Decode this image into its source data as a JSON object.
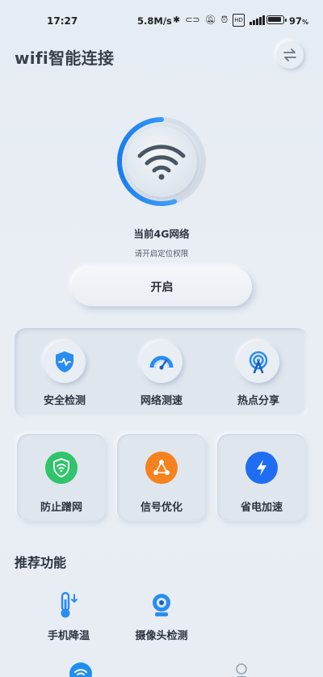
{
  "status_bar": {
    "time": "17:27",
    "speed": "5.8M/s",
    "battery_percent": "97"
  },
  "header": {
    "title": "wifi智能连接",
    "switch_icon": "swap-arrows-icon"
  },
  "connection": {
    "title": "当前4G网络",
    "subtitle": "请开启定位权限",
    "button_label": "开启",
    "ring_progress": 0.55,
    "accent": "#1f8ef1"
  },
  "tools": [
    {
      "label": "安全检测",
      "icon": "shield-pulse-icon"
    },
    {
      "label": "网络测速",
      "icon": "speedometer-icon"
    },
    {
      "label": "热点分享",
      "icon": "hotspot-icon"
    }
  ],
  "cards": [
    {
      "label": "防止蹭网",
      "icon": "wifi-shield-icon",
      "color": "#31c46a"
    },
    {
      "label": "信号优化",
      "icon": "share-nodes-icon",
      "color": "#f5821f"
    },
    {
      "label": "省电加速",
      "icon": "lightning-icon",
      "color": "#1f6ef1"
    }
  ],
  "recommend": {
    "title": "推荐功能",
    "items": [
      {
        "label": "手机降温",
        "icon": "thermometer-icon"
      },
      {
        "label": "摄像头检测",
        "icon": "camera-icon"
      }
    ]
  },
  "bottom_nav": [
    {
      "icon": "wifi-icon",
      "active": true
    },
    {
      "icon": "user-icon",
      "active": false
    }
  ]
}
